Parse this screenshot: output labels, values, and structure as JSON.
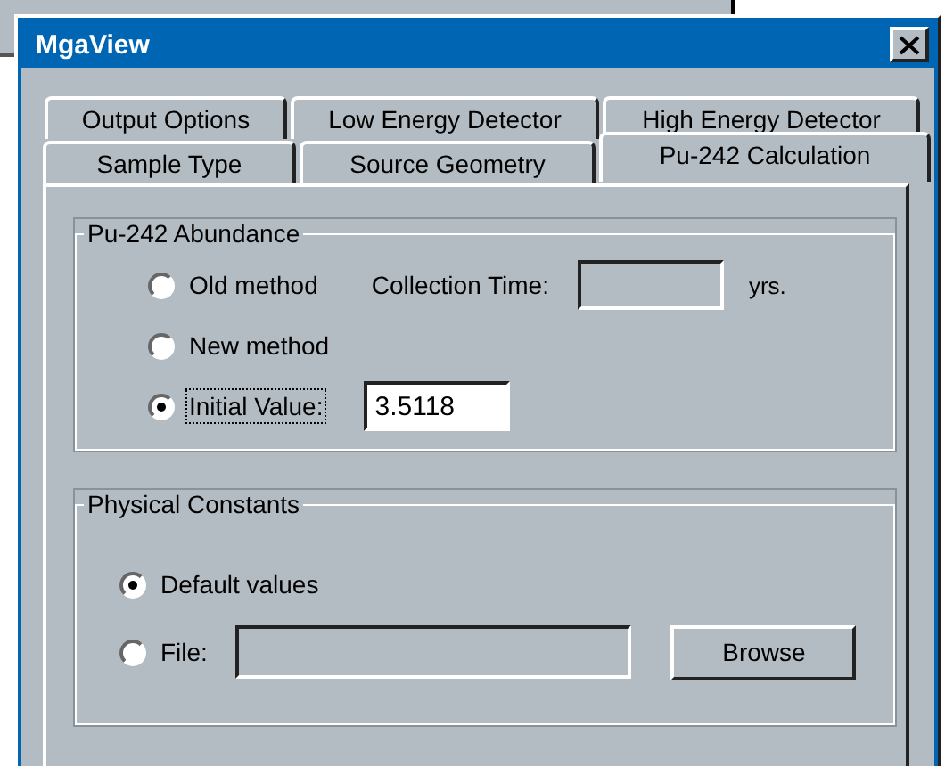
{
  "window": {
    "title": "MgaView"
  },
  "tabs": {
    "back_row": [
      {
        "label": "Output Options",
        "selected": false
      },
      {
        "label": "Low Energy Detector",
        "selected": false
      },
      {
        "label": "High Energy Detector",
        "selected": false
      }
    ],
    "front_row": [
      {
        "label": "Sample Type",
        "selected": false
      },
      {
        "label": "Source Geometry",
        "selected": false
      },
      {
        "label": "Pu-242 Calculation",
        "selected": true
      }
    ]
  },
  "abundance": {
    "title": "Pu-242 Abundance",
    "options": [
      {
        "label": "Old method",
        "selected": false
      },
      {
        "label": "New method",
        "selected": false
      },
      {
        "label": "Initial Value:",
        "selected": true
      }
    ],
    "collection_time": {
      "label": "Collection Time:",
      "unit": "yrs.",
      "disabled": true
    },
    "initial_value": {
      "value": "3.5118"
    }
  },
  "constants": {
    "title": "Physical Constants",
    "options": [
      {
        "label": "Default values",
        "selected": true
      },
      {
        "label": "File:",
        "selected": false
      }
    ],
    "file_field": {
      "disabled": true
    },
    "browse_button": "Browse"
  }
}
